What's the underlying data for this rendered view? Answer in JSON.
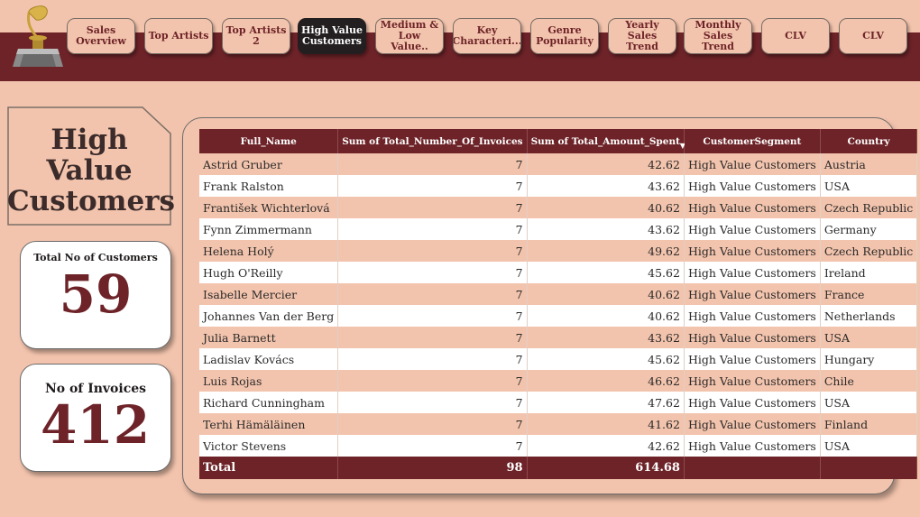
{
  "nav": {
    "buttons": [
      {
        "label": "Sales\nOverview",
        "active": false
      },
      {
        "label": "Top Artists",
        "active": false
      },
      {
        "label": "Top Artists 2",
        "active": false
      },
      {
        "label": "High Value\nCustomers",
        "active": true
      },
      {
        "label": "Medium &\nLow Value..",
        "active": false
      },
      {
        "label": "Key\nCharacteri...",
        "active": false
      },
      {
        "label": "Genre\nPopularity",
        "active": false
      },
      {
        "label": "Yearly Sales\nTrend",
        "active": false
      },
      {
        "label": "Monthly\nSales Trend",
        "active": false
      },
      {
        "label": "CLV",
        "active": false
      },
      {
        "label": "CLV",
        "active": false
      }
    ]
  },
  "page": {
    "title": "High Value\nCustomers",
    "logo_icon": "gramophone-award-icon"
  },
  "kpis": {
    "customers": {
      "label": "Total No of Customers",
      "value": "59"
    },
    "invoices": {
      "label": "No of Invoices",
      "value": "412"
    }
  },
  "table": {
    "columns": [
      "Full_Name",
      "Sum of Total_Number_Of_Invoices",
      "Sum of Total_Amount_Spent",
      "CustomerSegment",
      "Country"
    ],
    "sort_icon": "sort-descending-icon",
    "rows": [
      [
        "Astrid Gruber",
        "7",
        "42.62",
        "High Value Customers",
        "Austria"
      ],
      [
        "Frank Ralston",
        "7",
        "43.62",
        "High Value Customers",
        "USA"
      ],
      [
        "František Wichterlová",
        "7",
        "40.62",
        "High Value Customers",
        "Czech Republic"
      ],
      [
        "Fynn Zimmermann",
        "7",
        "43.62",
        "High Value Customers",
        "Germany"
      ],
      [
        "Helena Holý",
        "7",
        "49.62",
        "High Value Customers",
        "Czech Republic"
      ],
      [
        "Hugh O'Reilly",
        "7",
        "45.62",
        "High Value Customers",
        "Ireland"
      ],
      [
        "Isabelle Mercier",
        "7",
        "40.62",
        "High Value Customers",
        "France"
      ],
      [
        "Johannes Van der Berg",
        "7",
        "40.62",
        "High Value Customers",
        "Netherlands"
      ],
      [
        "Julia Barnett",
        "7",
        "43.62",
        "High Value Customers",
        "USA"
      ],
      [
        "Ladislav Kovács",
        "7",
        "45.62",
        "High Value Customers",
        "Hungary"
      ],
      [
        "Luis Rojas",
        "7",
        "46.62",
        "High Value Customers",
        "Chile"
      ],
      [
        "Richard Cunningham",
        "7",
        "47.62",
        "High Value Customers",
        "USA"
      ],
      [
        "Terhi Hämäläinen",
        "7",
        "41.62",
        "High Value Customers",
        "Finland"
      ],
      [
        "Victor Stevens",
        "7",
        "42.62",
        "High Value Customers",
        "USA"
      ]
    ],
    "total": [
      "Total",
      "98",
      "614.68",
      "",
      ""
    ]
  },
  "colors": {
    "accent": "#6d2328",
    "background": "#f3c4ad",
    "active_button": "#231f20"
  }
}
